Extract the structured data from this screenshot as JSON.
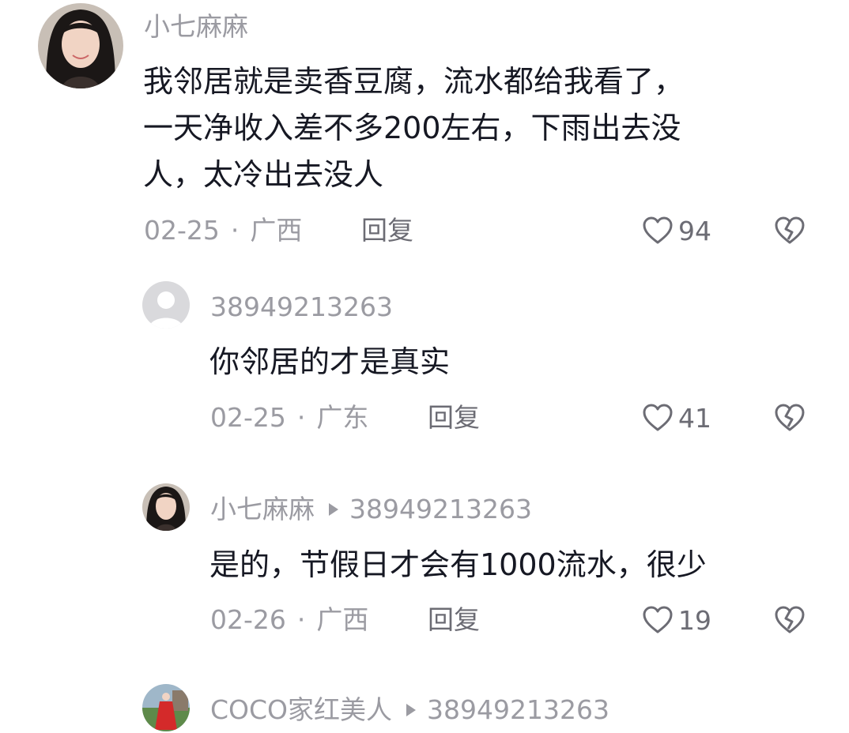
{
  "comments": [
    {
      "username": "小七麻麻",
      "text_lines": [
        "我邻居就是卖香豆腐，流水都给我看了，",
        "一天净收入差不多200左右，下雨出去没",
        "人，太冷出去没人"
      ],
      "date": "02-25",
      "location": "广西",
      "reply_label": "回复",
      "likes": "94"
    },
    {
      "username": "38949213263",
      "text_lines": [
        "你邻居的才是真实"
      ],
      "date": "02-25",
      "location": "广东",
      "reply_label": "回复",
      "likes": "41"
    },
    {
      "username": "小七麻麻",
      "reply_to": "38949213263",
      "text_lines": [
        "是的，节假日才会有1000流水，很少"
      ],
      "date": "02-26",
      "location": "广西",
      "reply_label": "回复",
      "likes": "19"
    },
    {
      "username": "COCO家红美人",
      "reply_to": "38949213263"
    }
  ],
  "separator": "·",
  "icons": {
    "like": "heart-outline-icon",
    "dislike": "broken-heart-icon",
    "reply_arrow": "triangle-right-icon"
  },
  "colors": {
    "meta_text": "#9b9ba2",
    "body_text": "#161823",
    "icon": "#6c6c74"
  }
}
